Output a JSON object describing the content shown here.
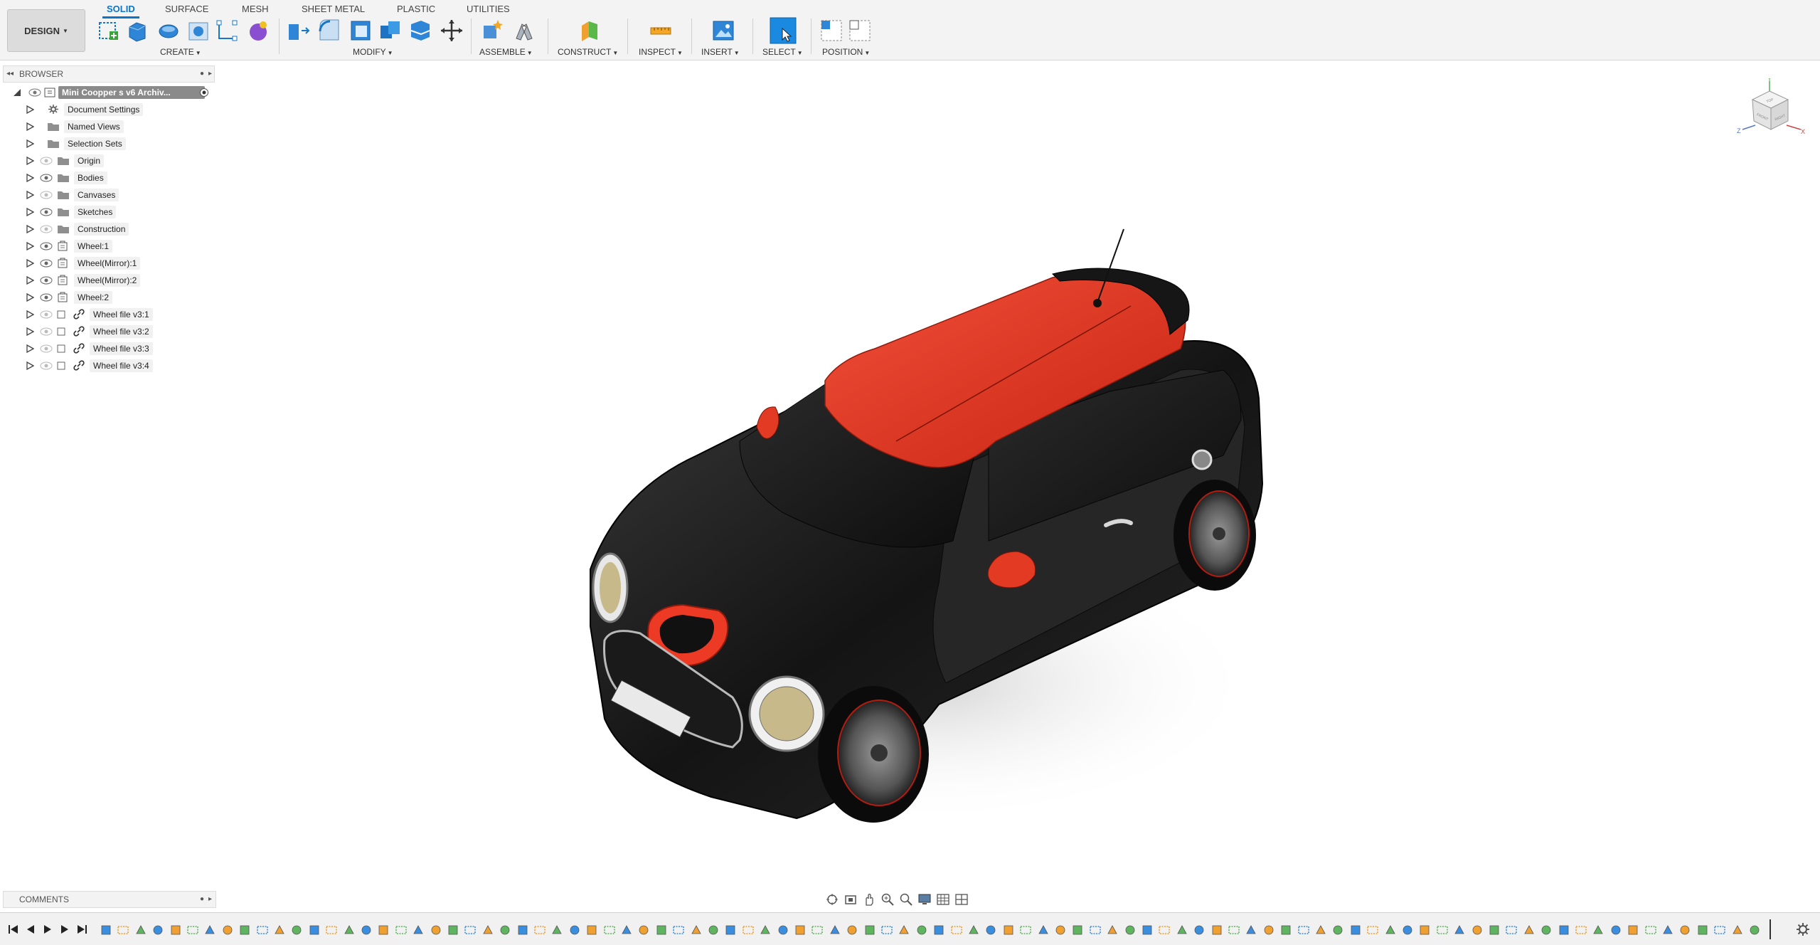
{
  "toolbar": {
    "workspace_button": "DESIGN",
    "tabs": [
      "SOLID",
      "SURFACE",
      "MESH",
      "SHEET METAL",
      "PLASTIC",
      "UTILITIES"
    ],
    "active_tab": "SOLID",
    "groups": {
      "create": "CREATE",
      "modify": "MODIFY",
      "assemble": "ASSEMBLE",
      "construct": "CONSTRUCT",
      "inspect": "INSPECT",
      "insert": "INSERT",
      "select": "SELECT",
      "position": "POSITION"
    },
    "accent_color": "#0b75c8"
  },
  "browser": {
    "title": "BROWSER",
    "root": "Mini Coopper s v6 Archiv...",
    "items": [
      {
        "label": "Document Settings",
        "icon": "gear-icon"
      },
      {
        "label": "Named Views",
        "icon": "folder-icon"
      },
      {
        "label": "Selection Sets",
        "icon": "folder-icon"
      },
      {
        "label": "Origin",
        "icon": "folder-icon"
      },
      {
        "label": "Bodies",
        "icon": "folder-icon"
      },
      {
        "label": "Canvases",
        "icon": "folder-icon"
      },
      {
        "label": "Sketches",
        "icon": "folder-icon"
      },
      {
        "label": "Construction",
        "icon": "folder-icon"
      },
      {
        "label": "Wheel:1",
        "icon": "component-icon"
      },
      {
        "label": "Wheel(Mirror):1",
        "icon": "component-icon"
      },
      {
        "label": "Wheel(Mirror):2",
        "icon": "component-icon"
      },
      {
        "label": "Wheel:2",
        "icon": "component-icon"
      },
      {
        "label": "Wheel file v3:1",
        "icon": "link-icon"
      },
      {
        "label": "Wheel file v3:2",
        "icon": "link-icon"
      },
      {
        "label": "Wheel file v3:3",
        "icon": "link-icon"
      },
      {
        "label": "Wheel file v3:4",
        "icon": "link-icon"
      }
    ]
  },
  "comments": {
    "title": "COMMENTS"
  },
  "viewcube": {
    "faces": [
      "TOP",
      "FRONT",
      "RIGHT"
    ],
    "axes": [
      "Y",
      "Z",
      "X"
    ]
  },
  "car": {
    "body_color": "#1c1c1c",
    "roof_color": "#e5321e"
  }
}
